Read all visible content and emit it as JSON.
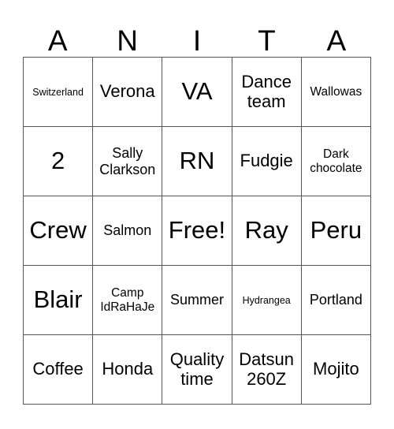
{
  "card": {
    "header_letters": [
      "A",
      "N",
      "I",
      "T",
      "A"
    ],
    "rows": [
      [
        {
          "text": "Switzerland",
          "size": "sz-xs"
        },
        {
          "text": "Verona",
          "size": "sz-l"
        },
        {
          "text": "VA",
          "size": "sz-xxl"
        },
        {
          "text": "Dance team",
          "size": "sz-l"
        },
        {
          "text": "Wallowas",
          "size": "sz-s"
        }
      ],
      [
        {
          "text": "2",
          "size": "sz-xxl"
        },
        {
          "text": "Sally Clarkson",
          "size": "sz-m"
        },
        {
          "text": "RN",
          "size": "sz-xxl"
        },
        {
          "text": "Fudgie",
          "size": "sz-l"
        },
        {
          "text": "Dark chocolate",
          "size": "sz-s"
        }
      ],
      [
        {
          "text": "Crew",
          "size": "sz-xxl"
        },
        {
          "text": "Salmon",
          "size": "sz-m"
        },
        {
          "text": "Free!",
          "size": "sz-xxl"
        },
        {
          "text": "Ray",
          "size": "sz-xxl"
        },
        {
          "text": "Peru",
          "size": "sz-xxl"
        }
      ],
      [
        {
          "text": "Blair",
          "size": "sz-xxl"
        },
        {
          "text": "Camp IdRaHaJe",
          "size": "sz-s"
        },
        {
          "text": "Summer",
          "size": "sz-m"
        },
        {
          "text": "Hydrangea",
          "size": "sz-xs"
        },
        {
          "text": "Portland",
          "size": "sz-m"
        }
      ],
      [
        {
          "text": "Coffee",
          "size": "sz-l"
        },
        {
          "text": "Honda",
          "size": "sz-l"
        },
        {
          "text": "Quality time",
          "size": "sz-l"
        },
        {
          "text": "Datsun 260Z",
          "size": "sz-l"
        },
        {
          "text": "Mojito",
          "size": "sz-l"
        }
      ]
    ]
  },
  "colors": {
    "background": "#ffffff",
    "text": "#000000",
    "grid_line": "#555555"
  }
}
